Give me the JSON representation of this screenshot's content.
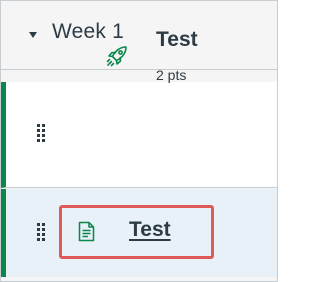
{
  "module": {
    "title": "Week 1",
    "caret_icon": "caret-down-icon"
  },
  "items": [
    {
      "type": "quiz",
      "icon": "rocket-icon",
      "title": "Test",
      "points": "2 pts",
      "published_color": "#0b874b"
    },
    {
      "type": "page",
      "icon": "document-icon",
      "title": "Test",
      "published_color": "#0b874b",
      "highlighted": true
    }
  ],
  "colors": {
    "published": "#0b874b",
    "text": "#2d3b45",
    "highlight": "#e05a5a",
    "selected_row": "#e8f1f8"
  }
}
